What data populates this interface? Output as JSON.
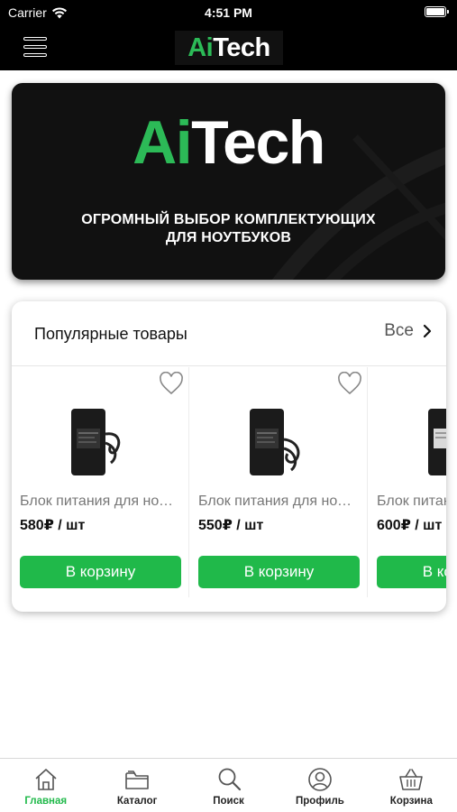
{
  "status_bar": {
    "carrier": "Carrier",
    "time": "4:51 PM"
  },
  "header": {
    "logo_ai": "Ai",
    "logo_tech": "Tech"
  },
  "banner": {
    "logo_ai": "Ai",
    "logo_tech": "Tech",
    "tagline_line1": "ОГРОМНЫЙ ВЫБОР КОМПЛЕКТУЮЩИХ",
    "tagline_line2": "ДЛЯ НОУТБУКОВ"
  },
  "popular": {
    "title": "Популярные товары",
    "all_label": "Все",
    "products": [
      {
        "name": "Блок питания для ноутбука",
        "price": "580₽ / шт",
        "button": "В корзину"
      },
      {
        "name": "Блок питания для ноутбука",
        "price": "550₽ / шт",
        "button": "В корзину"
      },
      {
        "name": "Блок питания для ноутбука",
        "price": "600₽ / шт",
        "button": "В корзину"
      }
    ]
  },
  "tabs": [
    {
      "label": "Главная",
      "icon": "home-icon",
      "active": true
    },
    {
      "label": "Каталог",
      "icon": "folder-icon",
      "active": false
    },
    {
      "label": "Поиск",
      "icon": "search-icon",
      "active": false
    },
    {
      "label": "Профиль",
      "icon": "profile-icon",
      "active": false
    },
    {
      "label": "Корзина",
      "icon": "basket-icon",
      "active": false
    }
  ],
  "colors": {
    "accent": "#20b94a",
    "logo_green": "#2cba57",
    "header_bg": "#000000"
  }
}
